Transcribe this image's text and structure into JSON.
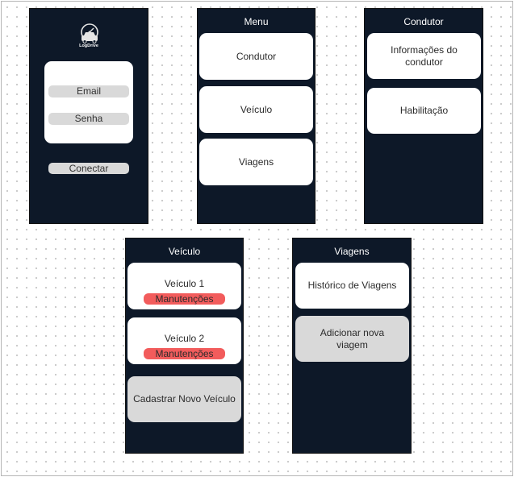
{
  "login": {
    "logo_text": "LogDrive",
    "email_label": "Email",
    "password_label": "Senha",
    "connect_label": "Conectar"
  },
  "menu": {
    "title": "Menu",
    "items": [
      "Condutor",
      "Veículo",
      "Viagens"
    ]
  },
  "driver": {
    "title": "Condutor",
    "items": [
      "Informações do condutor",
      "Habilitação"
    ]
  },
  "vehicle": {
    "title": "Veículo",
    "cards": [
      {
        "name": "Veículo 1",
        "action": "Manutenções"
      },
      {
        "name": "Veículo 2",
        "action": "Manutenções"
      }
    ],
    "register_label": "Cadastrar Novo Veículo"
  },
  "trips": {
    "title": "Viagens",
    "history_label": "Histórico de Viagens",
    "add_label": "Adicionar nova viagem"
  },
  "colors": {
    "phone_bg": "#0d1828",
    "card_bg": "#ffffff",
    "input_bg": "#d9d9d9",
    "danger": "#f25c5c"
  }
}
